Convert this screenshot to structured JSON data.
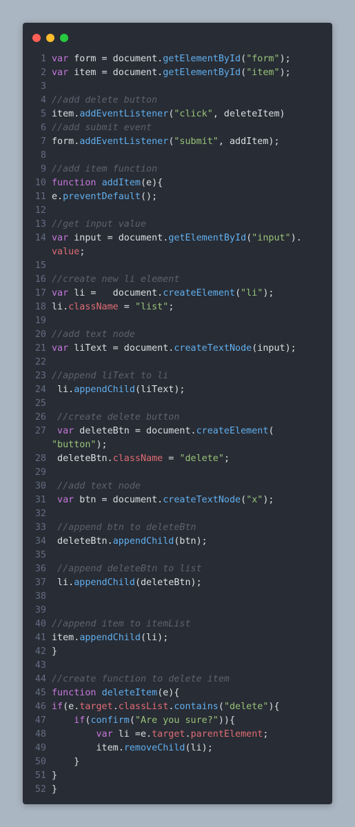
{
  "window": {
    "buttons": [
      {
        "name": "close",
        "color": "#ff5f56"
      },
      {
        "name": "minimize",
        "color": "#ffbd2e"
      },
      {
        "name": "maximize",
        "color": "#27c93f"
      }
    ]
  },
  "theme": {
    "background": "#282c34",
    "page_background": "#aab6c2",
    "keyword": "#c678dd",
    "function": "#61afef",
    "string": "#98c379",
    "property": "#e06c75",
    "comment": "#5c6370",
    "plain": "#dcdfe4",
    "line_number": "#636d83"
  },
  "code": {
    "lines": [
      {
        "num": "1",
        "tokens": [
          [
            "kw",
            "var"
          ],
          [
            "pl",
            " form = document."
          ],
          [
            "fn",
            "getElementById"
          ],
          [
            "pl",
            "("
          ],
          [
            "str",
            "\"form\""
          ],
          [
            "pl",
            ");"
          ]
        ]
      },
      {
        "num": "2",
        "tokens": [
          [
            "kw",
            "var"
          ],
          [
            "pl",
            " item = document."
          ],
          [
            "fn",
            "getElementById"
          ],
          [
            "pl",
            "("
          ],
          [
            "str",
            "\"item\""
          ],
          [
            "pl",
            ");"
          ]
        ]
      },
      {
        "num": "3",
        "tokens": []
      },
      {
        "num": "4",
        "tokens": [
          [
            "cm",
            "//add delete button"
          ]
        ]
      },
      {
        "num": "5",
        "tokens": [
          [
            "pl",
            "item."
          ],
          [
            "fn",
            "addEventListener"
          ],
          [
            "pl",
            "("
          ],
          [
            "str",
            "\"click\""
          ],
          [
            "pl",
            ", deleteItem)"
          ]
        ]
      },
      {
        "num": "6",
        "tokens": [
          [
            "cm",
            "//add submit event"
          ]
        ]
      },
      {
        "num": "7",
        "tokens": [
          [
            "pl",
            "form."
          ],
          [
            "fn",
            "addEventListener"
          ],
          [
            "pl",
            "("
          ],
          [
            "str",
            "\"submit\""
          ],
          [
            "pl",
            ", addItem);"
          ]
        ]
      },
      {
        "num": "8",
        "tokens": []
      },
      {
        "num": "9",
        "tokens": [
          [
            "cm",
            "//add item function"
          ]
        ]
      },
      {
        "num": "10",
        "tokens": [
          [
            "kw",
            "function"
          ],
          [
            "pl",
            " "
          ],
          [
            "fn",
            "addItem"
          ],
          [
            "pl",
            "(e){"
          ]
        ]
      },
      {
        "num": "11",
        "tokens": [
          [
            "pl",
            "e."
          ],
          [
            "fn",
            "preventDefault"
          ],
          [
            "pl",
            "();"
          ]
        ]
      },
      {
        "num": "12",
        "tokens": []
      },
      {
        "num": "13",
        "tokens": [
          [
            "cm",
            "//get input value"
          ]
        ]
      },
      {
        "num": "14",
        "tokens": [
          [
            "kw",
            "var"
          ],
          [
            "pl",
            " input = document."
          ],
          [
            "fn",
            "getElementById"
          ],
          [
            "pl",
            "("
          ],
          [
            "str",
            "\"input\""
          ],
          [
            "pl",
            ")."
          ]
        ]
      },
      {
        "num": "",
        "tokens": [
          [
            "prop",
            "value"
          ],
          [
            "pl",
            ";"
          ]
        ]
      },
      {
        "num": "15",
        "tokens": []
      },
      {
        "num": "16",
        "tokens": [
          [
            "cm",
            "//create new li element"
          ]
        ]
      },
      {
        "num": "17",
        "tokens": [
          [
            "kw",
            "var"
          ],
          [
            "pl",
            " li =   document."
          ],
          [
            "fn",
            "createElement"
          ],
          [
            "pl",
            "("
          ],
          [
            "str",
            "\"li\""
          ],
          [
            "pl",
            ");"
          ]
        ]
      },
      {
        "num": "18",
        "tokens": [
          [
            "pl",
            "li."
          ],
          [
            "prop",
            "className"
          ],
          [
            "pl",
            " = "
          ],
          [
            "str",
            "\"list\""
          ],
          [
            "pl",
            ";"
          ]
        ]
      },
      {
        "num": "19",
        "tokens": []
      },
      {
        "num": "20",
        "tokens": [
          [
            "cm",
            "//add text node"
          ]
        ]
      },
      {
        "num": "21",
        "tokens": [
          [
            "kw",
            "var"
          ],
          [
            "pl",
            " liText = document."
          ],
          [
            "fn",
            "createTextNode"
          ],
          [
            "pl",
            "(input);"
          ]
        ]
      },
      {
        "num": "22",
        "tokens": []
      },
      {
        "num": "23",
        "tokens": [
          [
            "cm",
            "//append liText to li"
          ]
        ]
      },
      {
        "num": "24",
        "tokens": [
          [
            "pl",
            " li."
          ],
          [
            "fn",
            "appendChild"
          ],
          [
            "pl",
            "(liText);"
          ]
        ]
      },
      {
        "num": "25",
        "tokens": []
      },
      {
        "num": "26",
        "tokens": [
          [
            "cm",
            " //create delete button"
          ]
        ]
      },
      {
        "num": "27",
        "tokens": [
          [
            "kw",
            " var"
          ],
          [
            "pl",
            " deleteBtn = document."
          ],
          [
            "fn",
            "createElement"
          ],
          [
            "pl",
            "("
          ]
        ]
      },
      {
        "num": "",
        "tokens": [
          [
            "str",
            "\"button\""
          ],
          [
            "pl",
            ");"
          ]
        ]
      },
      {
        "num": "28",
        "tokens": [
          [
            "pl",
            " deleteBtn."
          ],
          [
            "prop",
            "className"
          ],
          [
            "pl",
            " = "
          ],
          [
            "str",
            "\"delete\""
          ],
          [
            "pl",
            ";"
          ]
        ]
      },
      {
        "num": "29",
        "tokens": []
      },
      {
        "num": "30",
        "tokens": [
          [
            "cm",
            " //add text node"
          ]
        ]
      },
      {
        "num": "31",
        "tokens": [
          [
            "kw",
            " var"
          ],
          [
            "pl",
            " btn = document."
          ],
          [
            "fn",
            "createTextNode"
          ],
          [
            "pl",
            "("
          ],
          [
            "str",
            "\"x\""
          ],
          [
            "pl",
            ");"
          ]
        ]
      },
      {
        "num": "32",
        "tokens": []
      },
      {
        "num": "33",
        "tokens": [
          [
            "cm",
            " //append btn to deleteBtn"
          ]
        ]
      },
      {
        "num": "34",
        "tokens": [
          [
            "pl",
            " deleteBtn."
          ],
          [
            "fn",
            "appendChild"
          ],
          [
            "pl",
            "(btn);"
          ]
        ]
      },
      {
        "num": "35",
        "tokens": []
      },
      {
        "num": "36",
        "tokens": [
          [
            "cm",
            " //append deleteBtn to list"
          ]
        ]
      },
      {
        "num": "37",
        "tokens": [
          [
            "pl",
            " li."
          ],
          [
            "fn",
            "appendChild"
          ],
          [
            "pl",
            "(deleteBtn);"
          ]
        ]
      },
      {
        "num": "38",
        "tokens": []
      },
      {
        "num": "39",
        "tokens": []
      },
      {
        "num": "40",
        "tokens": [
          [
            "cm",
            "//append item to itemList"
          ]
        ]
      },
      {
        "num": "41",
        "tokens": [
          [
            "pl",
            "item."
          ],
          [
            "fn",
            "appendChild"
          ],
          [
            "pl",
            "(li);"
          ]
        ]
      },
      {
        "num": "42",
        "tokens": [
          [
            "pl",
            "}"
          ]
        ]
      },
      {
        "num": "43",
        "tokens": []
      },
      {
        "num": "44",
        "tokens": [
          [
            "cm",
            "//create function to delete item"
          ]
        ]
      },
      {
        "num": "45",
        "tokens": [
          [
            "kw",
            "function"
          ],
          [
            "pl",
            " "
          ],
          [
            "fn",
            "deleteItem"
          ],
          [
            "pl",
            "(e){"
          ]
        ]
      },
      {
        "num": "46",
        "tokens": [
          [
            "kw",
            "if"
          ],
          [
            "pl",
            "(e."
          ],
          [
            "prop",
            "target"
          ],
          [
            "pl",
            "."
          ],
          [
            "prop",
            "classList"
          ],
          [
            "pl",
            "."
          ],
          [
            "fn",
            "contains"
          ],
          [
            "pl",
            "("
          ],
          [
            "str",
            "\"delete\""
          ],
          [
            "pl",
            "){"
          ]
        ]
      },
      {
        "num": "47",
        "tokens": [
          [
            "pl",
            "    "
          ],
          [
            "kw",
            "if"
          ],
          [
            "pl",
            "("
          ],
          [
            "fn",
            "confirm"
          ],
          [
            "pl",
            "("
          ],
          [
            "str",
            "\"Are you sure?\""
          ],
          [
            "pl",
            ")){"
          ]
        ]
      },
      {
        "num": "48",
        "tokens": [
          [
            "pl",
            "        "
          ],
          [
            "kw",
            "var"
          ],
          [
            "pl",
            " li =e."
          ],
          [
            "prop",
            "target"
          ],
          [
            "pl",
            "."
          ],
          [
            "prop",
            "parentElement"
          ],
          [
            "pl",
            ";"
          ]
        ]
      },
      {
        "num": "49",
        "tokens": [
          [
            "pl",
            "        item."
          ],
          [
            "fn",
            "removeChild"
          ],
          [
            "pl",
            "(li);"
          ]
        ]
      },
      {
        "num": "50",
        "tokens": [
          [
            "pl",
            "    }"
          ]
        ]
      },
      {
        "num": "51",
        "tokens": [
          [
            "pl",
            "}"
          ]
        ]
      },
      {
        "num": "52",
        "tokens": [
          [
            "pl",
            "}"
          ]
        ]
      }
    ]
  }
}
